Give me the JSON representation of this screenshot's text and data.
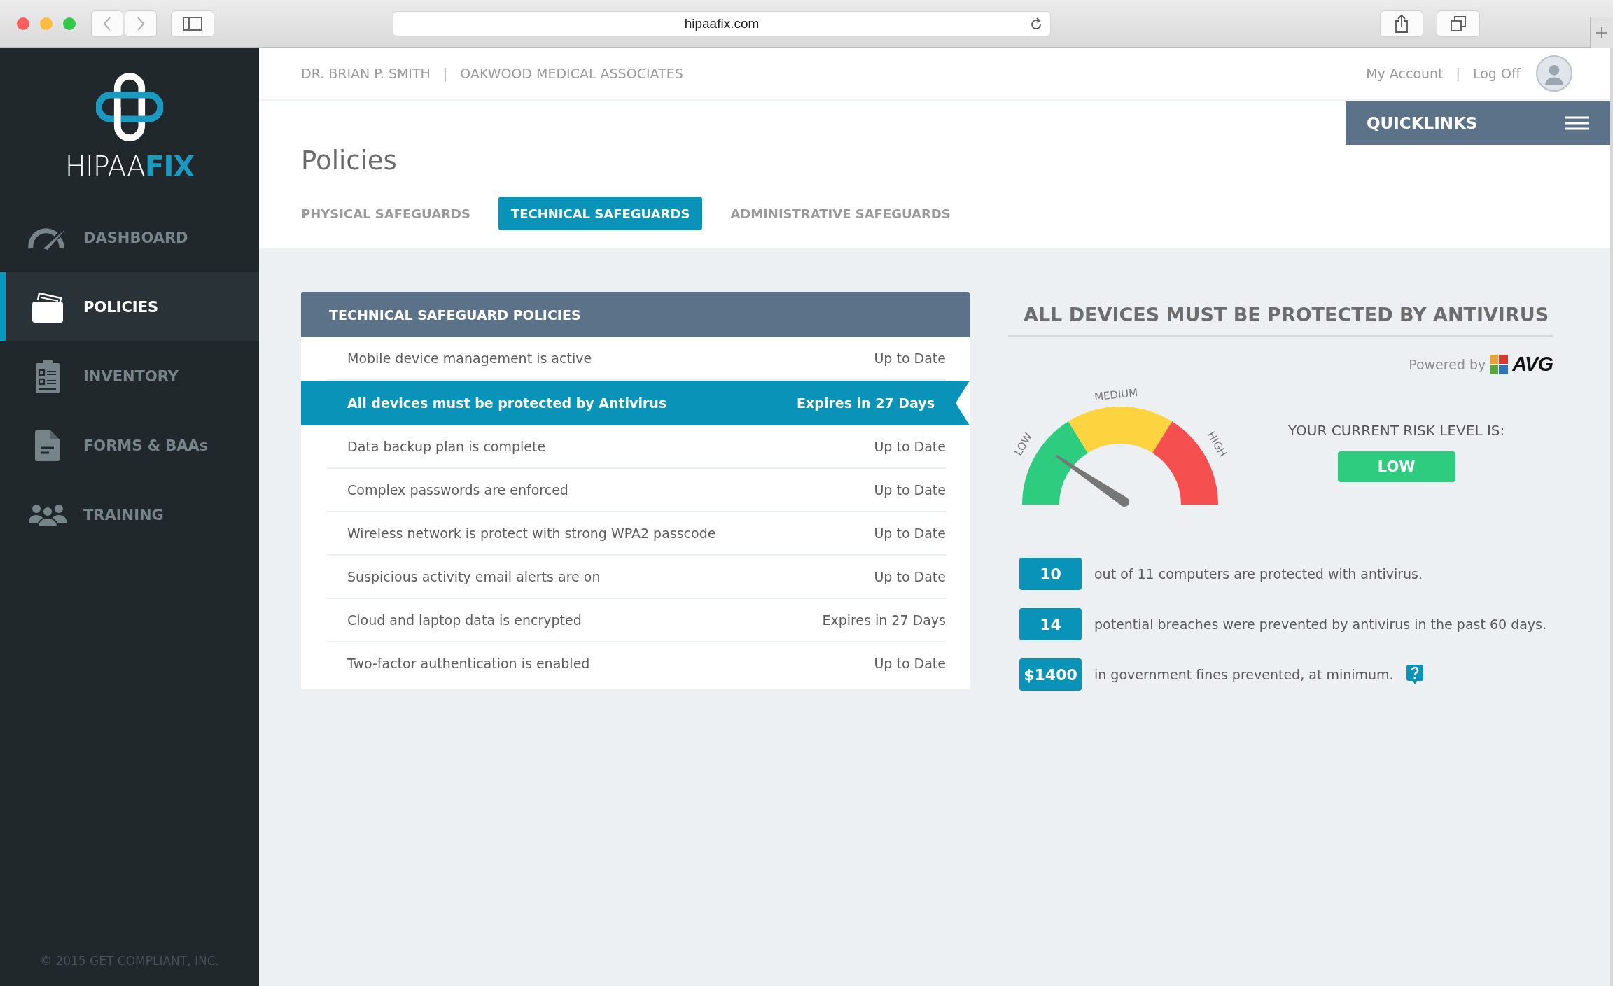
{
  "browser": {
    "url": "hipaafix.com"
  },
  "sidebar": {
    "logo": {
      "light": "HIPAA",
      "accent": "FIX"
    },
    "items": [
      {
        "label": "DASHBOARD",
        "kind": "gauge",
        "selected": false
      },
      {
        "label": "POLICIES",
        "kind": "folder",
        "selected": true
      },
      {
        "label": "INVENTORY",
        "kind": "clipboard",
        "selected": false
      },
      {
        "label": "FORMS & BAAs",
        "kind": "document",
        "selected": false
      },
      {
        "label": "TRAINING",
        "kind": "people",
        "selected": false
      }
    ],
    "footer": "© 2015 GET COMPLIANT, INC."
  },
  "header": {
    "user": "DR. BRIAN P. SMITH",
    "separator": "|",
    "practice": "OAKWOOD MEDICAL ASSOCIATES",
    "account_link": "My Account",
    "link_separator": "|",
    "logoff_link": "Log Off",
    "quicklinks": "QUICKLINKS"
  },
  "page": {
    "title": "Policies",
    "tabs": [
      {
        "label": "PHYSICAL SAFEGUARDS",
        "selected": false
      },
      {
        "label": "TECHNICAL SAFEGUARDS",
        "selected": true
      },
      {
        "label": "ADMINISTRATIVE SAFEGUARDS",
        "selected": false
      }
    ]
  },
  "table": {
    "title": "TECHNICAL SAFEGUARD POLICIES",
    "rows": [
      {
        "policy": "Mobile device management is active",
        "status": "Up to Date",
        "selected": false
      },
      {
        "policy": "All devices must be protected by Antivirus",
        "status": "Expires in 27 Days",
        "selected": true
      },
      {
        "policy": "Data backup plan is complete",
        "status": "Up to Date",
        "selected": false
      },
      {
        "policy": "Complex passwords are enforced",
        "status": "Up to Date",
        "selected": false
      },
      {
        "policy": "Wireless network is protect with strong WPA2 passcode",
        "status": "Up to Date",
        "selected": false
      },
      {
        "policy": "Suspicious activity email alerts are on",
        "status": "Up to Date",
        "selected": false
      },
      {
        "policy": "Cloud and laptop data is encrypted",
        "status": "Expires in 27 Days",
        "selected": false
      },
      {
        "policy": "Two-factor authentication is enabled",
        "status": "Up to Date",
        "selected": false
      }
    ]
  },
  "panel": {
    "title": "ALL DEVICES MUST BE PROTECTED BY ANTIVIRUS",
    "powered_by": "Powered by",
    "brand": "AVG",
    "gauge": {
      "low": "LOW",
      "medium": "MEDIUM",
      "high": "HIGH"
    },
    "risk_label": "YOUR CURRENT RISK LEVEL IS:",
    "risk": {
      "text": "LOW",
      "kind": "low"
    },
    "stats": [
      {
        "value": "10",
        "text": "out of 11 computers are protected with antivirus.",
        "help": false
      },
      {
        "value": "14",
        "text": "potential breaches were prevented by antivirus in the past 60 days.",
        "help": false
      },
      {
        "value": "$1400",
        "text": "in government fines prevented, at minimum.",
        "help": true
      }
    ]
  }
}
